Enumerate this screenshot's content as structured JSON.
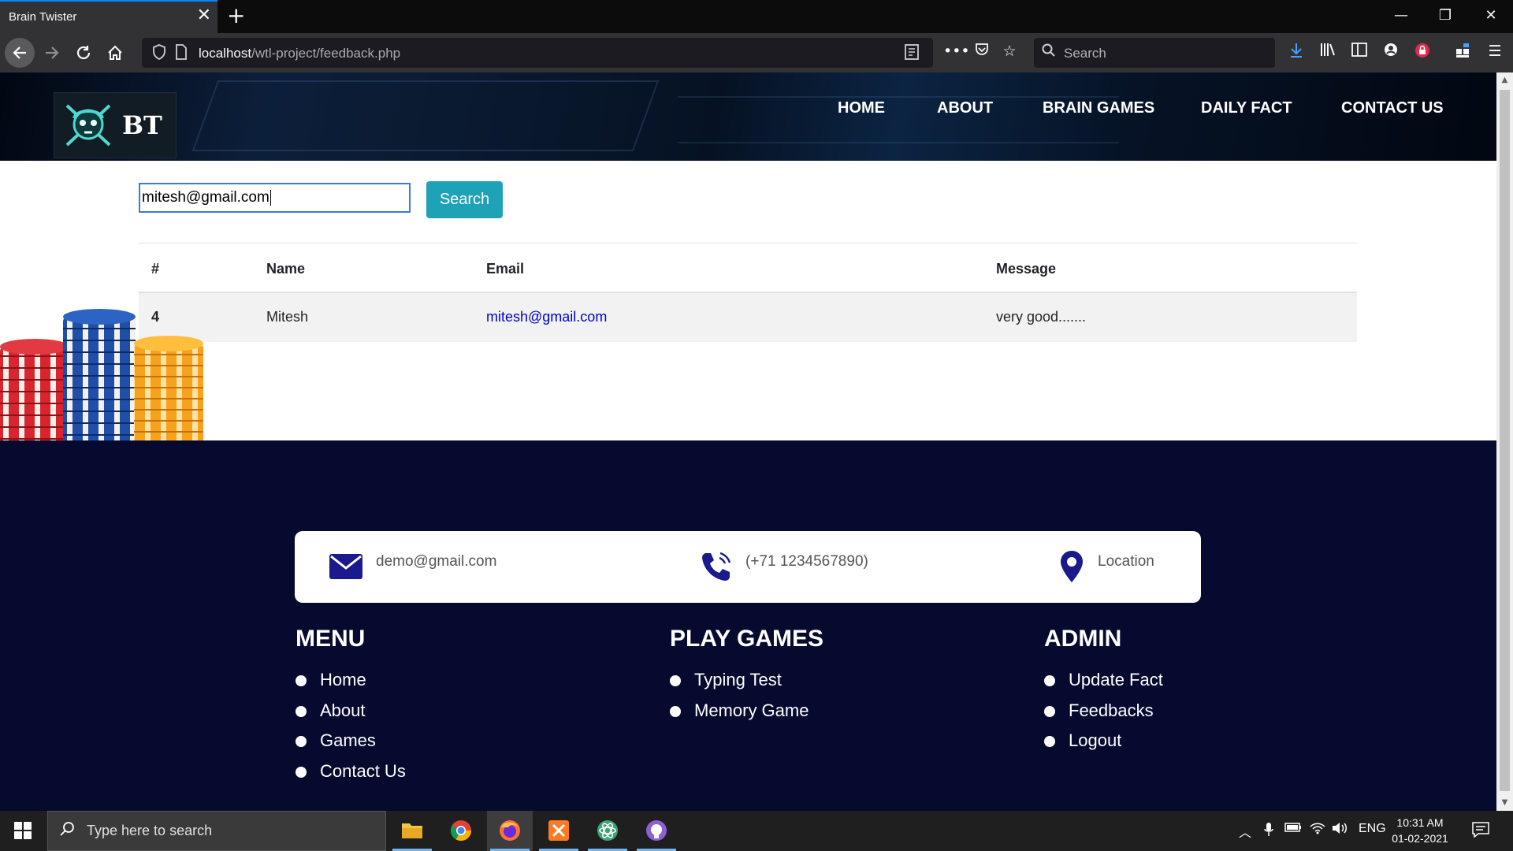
{
  "browser": {
    "tab_title": "Brain Twister",
    "tab_close": "✕",
    "new_tab": "+",
    "url_host": "localhost",
    "url_path": "/wtl-project/feedback.php",
    "search_placeholder": "Search",
    "window_controls": [
      "—",
      "❐",
      "✕"
    ]
  },
  "site": {
    "logo_text": "BT",
    "nav": [
      "HOME",
      "ABOUT",
      "BRAIN GAMES",
      "DAILY FACT",
      "CONTACT US"
    ]
  },
  "search": {
    "value": "mitesh@gmail.com",
    "button": "Search"
  },
  "table": {
    "headers": [
      "#",
      "Name",
      "Email",
      "Message"
    ],
    "rows": [
      {
        "id": "4",
        "name": "Mitesh",
        "email": "mitesh@gmail.com",
        "message": "very good......."
      }
    ]
  },
  "footer": {
    "contact": {
      "email": "demo@gmail.com",
      "phone": "(+71 1234567890)",
      "location": "Location"
    },
    "menu": {
      "title": "MENU",
      "items": [
        "Home",
        "About",
        "Games",
        "Contact Us"
      ]
    },
    "games": {
      "title": "PLAY GAMES",
      "items": [
        "Typing Test",
        "Memory Game"
      ]
    },
    "admin": {
      "title": "ADMIN",
      "items": [
        "Update Fact",
        "Feedbacks",
        "Logout"
      ]
    }
  },
  "taskbar": {
    "search_placeholder": "Type here to search",
    "lang": "ENG",
    "time": "10:31 AM",
    "date": "01-02-2021"
  },
  "colors": {
    "footer_bg": "#060a2f",
    "search_button": "#1ea2b8",
    "link": "#0000cc",
    "contact_icon": "#1a1a8c"
  }
}
